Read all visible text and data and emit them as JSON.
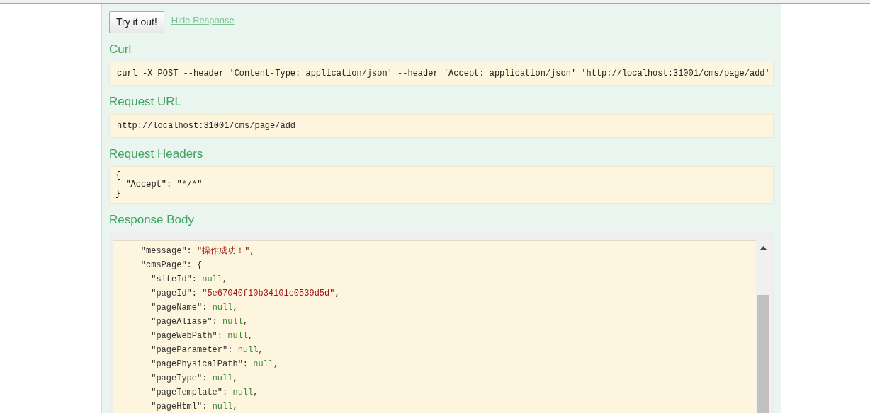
{
  "try_button": "Try it out!",
  "hide_link": "Hide Response",
  "sections": [
    {
      "title": "Curl",
      "kind": "single",
      "lines": [
        "curl -X POST --header 'Content-Type: application/json' --header 'Accept: application/json' 'http://localhost:31001/cms/page/add'"
      ]
    },
    {
      "title": "Request URL",
      "kind": "single",
      "lines": [
        "http://localhost:31001/cms/page/add"
      ]
    },
    {
      "title": "Request Headers",
      "kind": "multi",
      "lines": [
        "{",
        "  \"Accept\": \"*/*\"",
        "}"
      ]
    }
  ],
  "response_title": "Response Body",
  "response_lines": [
    {
      "key": "    \"message\": ",
      "value": "\"操作成功！\"",
      "kind": "string",
      "tail": ","
    },
    {
      "key": "    \"cmsPage\": ",
      "value": "{",
      "kind": "plain"
    },
    {
      "key": "      \"siteId\": ",
      "value": "null",
      "kind": "null",
      "tail": ","
    },
    {
      "key": "      \"pageId\": ",
      "value": "\"5e67040f10b34101c0539d5d\"",
      "kind": "string",
      "tail": ","
    },
    {
      "key": "      \"pageName\": ",
      "value": "null",
      "kind": "null",
      "tail": ","
    },
    {
      "key": "      \"pageAliase\": ",
      "value": "null",
      "kind": "null",
      "tail": ","
    },
    {
      "key": "      \"pageWebPath\": ",
      "value": "null",
      "kind": "null",
      "tail": ","
    },
    {
      "key": "      \"pageParameter\": ",
      "value": "null",
      "kind": "null",
      "tail": ","
    },
    {
      "key": "      \"pagePhysicalPath\": ",
      "value": "null",
      "kind": "null",
      "tail": ","
    },
    {
      "key": "      \"pageType\": ",
      "value": "null",
      "kind": "null",
      "tail": ","
    },
    {
      "key": "      \"pageTemplate\": ",
      "value": "null",
      "kind": "null",
      "tail": ","
    },
    {
      "key": "      \"pageHtml\": ",
      "value": "null",
      "kind": "null",
      "tail": ","
    }
  ]
}
